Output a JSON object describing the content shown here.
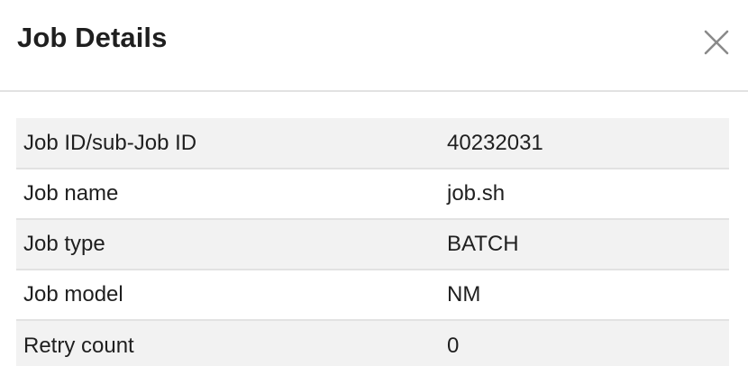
{
  "dialog": {
    "title": "Job Details",
    "close_icon": "close-icon"
  },
  "details": {
    "rows": [
      {
        "label": "Job ID/sub-Job ID",
        "value": "40232031"
      },
      {
        "label": "Job name",
        "value": "job.sh"
      },
      {
        "label": "Job type",
        "value": "BATCH"
      },
      {
        "label": "Job model",
        "value": "NM"
      },
      {
        "label": "Retry count",
        "value": "0"
      }
    ]
  },
  "colors": {
    "stripe": "#f2f2f2",
    "divider": "#e2e2e2",
    "text": "#1f1f1f",
    "close_icon": "#8a8a8a"
  }
}
